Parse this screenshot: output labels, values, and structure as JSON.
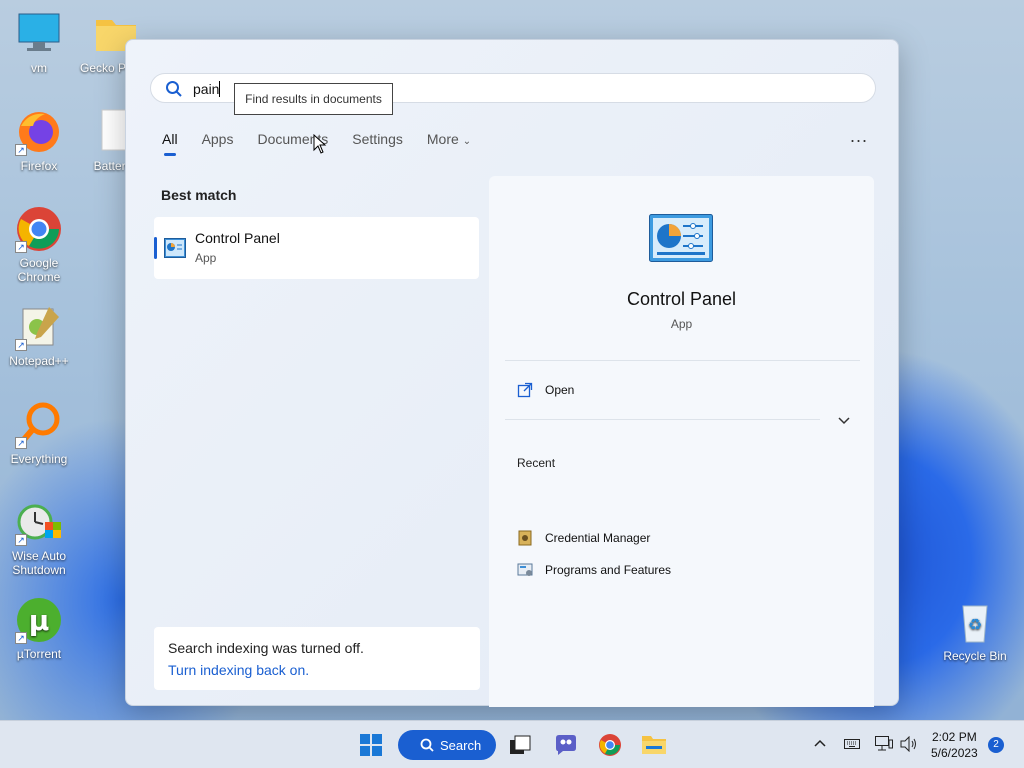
{
  "desktop": {
    "icons": [
      {
        "label": "vm",
        "icon": "monitor-icon"
      },
      {
        "label": "Gecko PixelP",
        "icon": "folder-icon"
      },
      {
        "label": "Firefox",
        "icon": "firefox-icon"
      },
      {
        "label": "Battery_",
        "icon": "file-icon"
      },
      {
        "label": "Google Chrome",
        "icon": "chrome-icon"
      },
      {
        "label": "Notepad++",
        "icon": "notepadpp-icon"
      },
      {
        "label": "Everything",
        "icon": "search-magnifier-icon"
      },
      {
        "label": "Wise Auto Shutdown",
        "icon": "clock-icon"
      },
      {
        "label": "µTorrent",
        "icon": "utorrent-icon"
      },
      {
        "label": "Recycle Bin",
        "icon": "recycle-bin-icon"
      }
    ]
  },
  "search": {
    "query": "pain",
    "tooltip": "Find results in documents",
    "tabs": [
      {
        "label": "All",
        "active": true
      },
      {
        "label": "Apps"
      },
      {
        "label": "Documents"
      },
      {
        "label": "Settings"
      },
      {
        "label": "More"
      }
    ],
    "more_menu": "...",
    "best_match_label": "Best match",
    "best_match": {
      "name": "Control Panel",
      "type": "App"
    },
    "indexing": {
      "message": "Search indexing was turned off.",
      "link": "Turn indexing back on."
    },
    "detail": {
      "name": "Control Panel",
      "type": "App",
      "open_label": "Open",
      "recent_label": "Recent",
      "recent_items": [
        "Credential Manager",
        "Programs and Features"
      ]
    }
  },
  "taskbar": {
    "search_label": "Search",
    "time": "2:02 PM",
    "date": "5/6/2023",
    "notification_count": "2"
  },
  "colors": {
    "accent": "#1a5fd1"
  }
}
